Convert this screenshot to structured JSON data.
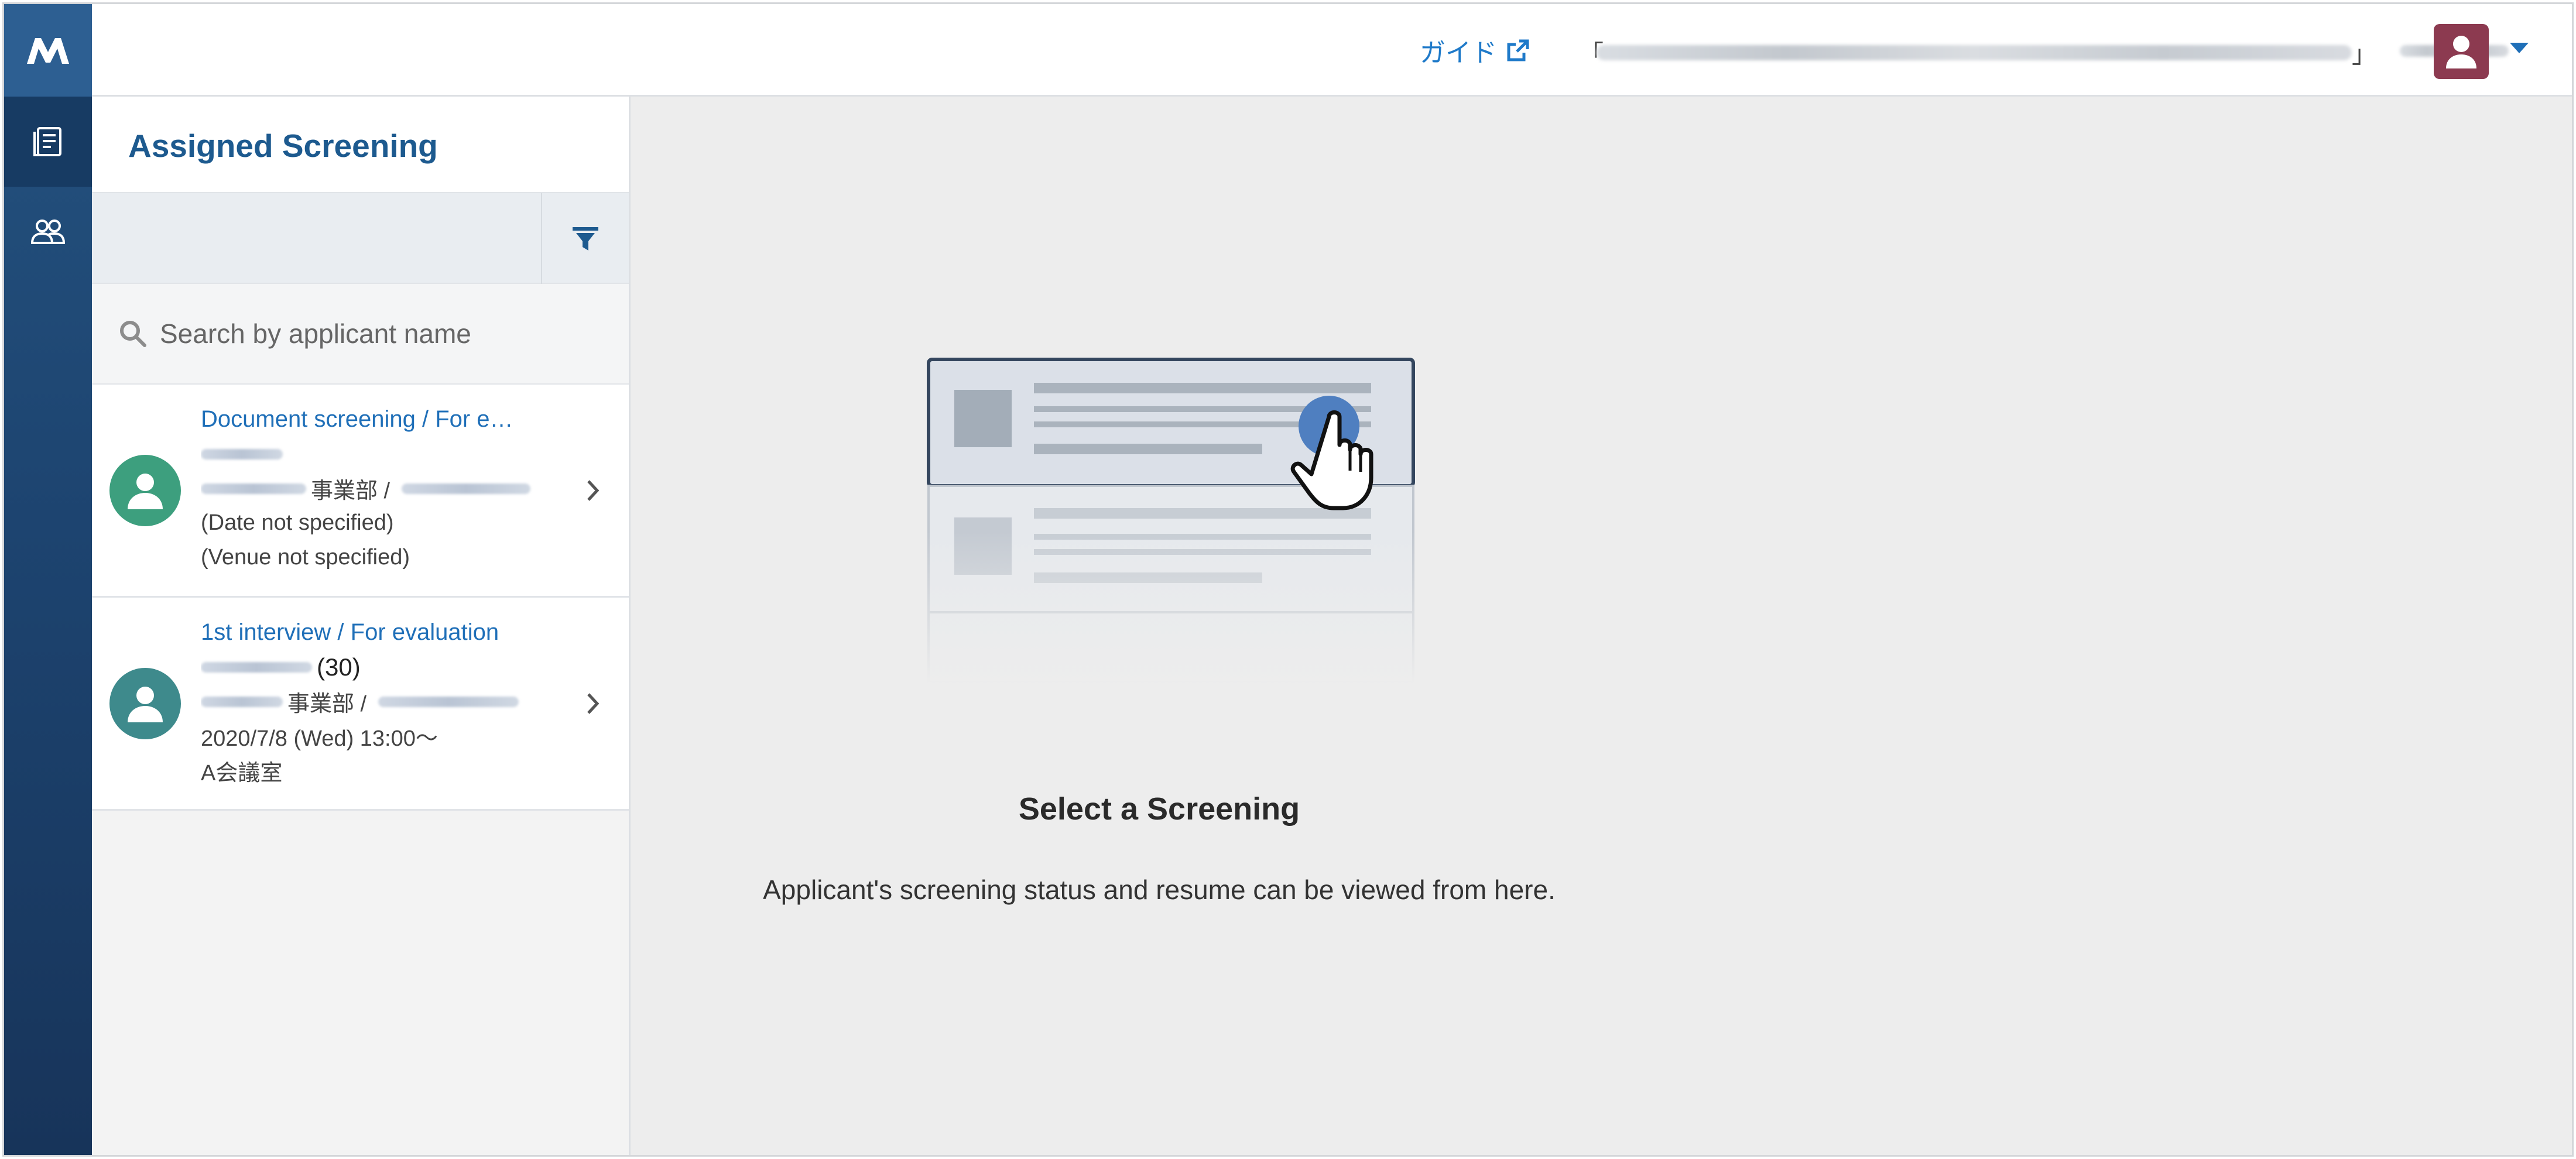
{
  "header": {
    "guide_label": "ガイド",
    "bracket_open": "「",
    "bracket_close": "」"
  },
  "sidebar": {
    "title": "Assigned Screening",
    "search": {
      "placeholder": "Search by applicant name",
      "value": ""
    }
  },
  "applicants": [
    {
      "stage": "Document screening  /  For e…",
      "department_suffix": "事業部  /",
      "date": "(Date not specified)",
      "venue": "(Venue not specified)",
      "avatar_color": "#3d9f7e"
    },
    {
      "stage": "1st interview  /  For evaluation",
      "age": "(30)",
      "department_suffix": "事業部  /",
      "date": "2020/7/8 (Wed) 13:00～",
      "venue": "A会議室",
      "avatar_color": "#3e8a8c"
    }
  ],
  "main": {
    "empty_title": "Select a Screening",
    "empty_subtitle": "Applicant's screening status and resume can be viewed from here."
  },
  "colors": {
    "brand": "#1d4470",
    "link": "#1f7ac9",
    "user_avatar": "#8c3a50"
  }
}
